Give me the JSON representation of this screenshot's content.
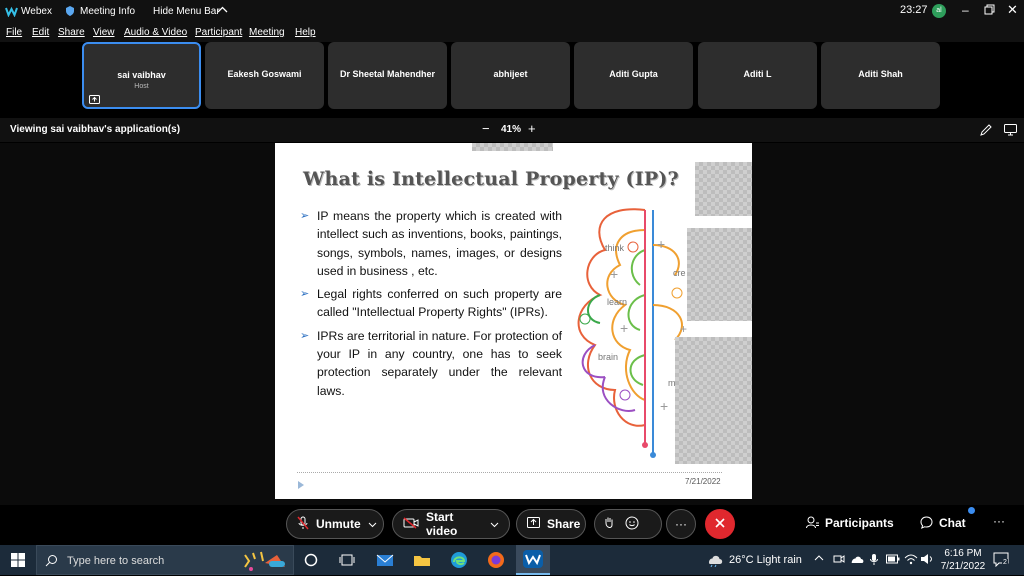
{
  "titlebar": {
    "app_name": "Webex",
    "meeting_info": "Meeting Info",
    "hide_menu_bar": "Hide Menu Bar",
    "clock": "23:27",
    "avatar_initials": "al"
  },
  "menubar": {
    "items": [
      "File",
      "Edit",
      "Share",
      "View",
      "Audio & Video",
      "Participant",
      "Meeting",
      "Help"
    ]
  },
  "participants": [
    {
      "name": "sai vaibhav",
      "role": "Host"
    },
    {
      "name": "Eakesh Goswami"
    },
    {
      "name": "Dr Sheetal Mahendher"
    },
    {
      "name": "abhijeet"
    },
    {
      "name": "Aditi Gupta"
    },
    {
      "name": "Aditi L"
    },
    {
      "name": "Aditi Shah"
    }
  ],
  "viewbar": {
    "viewing_text": "Viewing sai vaibhav's application(s)",
    "zoom_minus": "−",
    "zoom_level": "41%",
    "zoom_plus": "+"
  },
  "slide": {
    "title": "What is Intellectual Property (IP)?",
    "bullets": [
      "IP means the property which is created with  intellect such as inventions, books, paintings, songs, symbols, names, images, or designs used in business , etc.",
      "Legal rights conferred on such property are  called \"Intellectual Property Rights\" (IPRs).",
      "IPRs  are  territorial  in  nature.  For protection   of your IP  in any country, one has to seek  protection separately under the relevant  laws."
    ],
    "brain_words": [
      "think",
      "learn",
      "brain",
      "cre",
      "m"
    ],
    "date": "7/21/2022",
    "accent_color": "#2a6fc1"
  },
  "controls": {
    "unmute": "Unmute",
    "start_video": "Start video",
    "share": "Share",
    "more": "···",
    "participants": "Participants",
    "chat": "Chat",
    "overflow": "···"
  },
  "taskbar": {
    "search_placeholder": "Type here to search",
    "weather": "26°C  Light rain",
    "time": "6:16 PM",
    "date": "7/21/2022",
    "notification_count": "2"
  },
  "colors": {
    "end_call": "#e0282e",
    "active_border": "#3b8df0",
    "taskbar": "#1c2b3a"
  }
}
